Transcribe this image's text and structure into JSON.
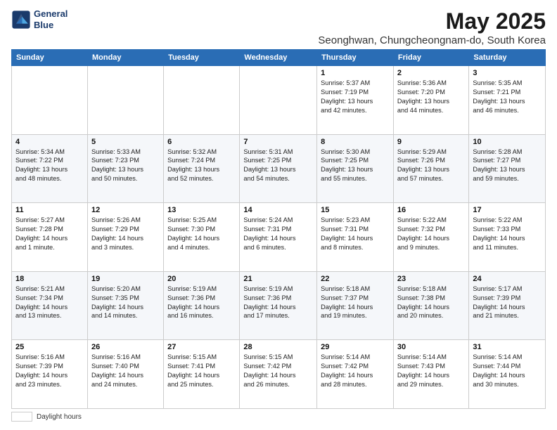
{
  "header": {
    "logo_line1": "General",
    "logo_line2": "Blue",
    "title": "May 2025",
    "subtitle": "Seonghwan, Chungcheongnam-do, South Korea"
  },
  "days_of_week": [
    "Sunday",
    "Monday",
    "Tuesday",
    "Wednesday",
    "Thursday",
    "Friday",
    "Saturday"
  ],
  "weeks": [
    [
      {
        "day": "",
        "info": ""
      },
      {
        "day": "",
        "info": ""
      },
      {
        "day": "",
        "info": ""
      },
      {
        "day": "",
        "info": ""
      },
      {
        "day": "1",
        "info": "Sunrise: 5:37 AM\nSunset: 7:19 PM\nDaylight: 13 hours\nand 42 minutes."
      },
      {
        "day": "2",
        "info": "Sunrise: 5:36 AM\nSunset: 7:20 PM\nDaylight: 13 hours\nand 44 minutes."
      },
      {
        "day": "3",
        "info": "Sunrise: 5:35 AM\nSunset: 7:21 PM\nDaylight: 13 hours\nand 46 minutes."
      }
    ],
    [
      {
        "day": "4",
        "info": "Sunrise: 5:34 AM\nSunset: 7:22 PM\nDaylight: 13 hours\nand 48 minutes."
      },
      {
        "day": "5",
        "info": "Sunrise: 5:33 AM\nSunset: 7:23 PM\nDaylight: 13 hours\nand 50 minutes."
      },
      {
        "day": "6",
        "info": "Sunrise: 5:32 AM\nSunset: 7:24 PM\nDaylight: 13 hours\nand 52 minutes."
      },
      {
        "day": "7",
        "info": "Sunrise: 5:31 AM\nSunset: 7:25 PM\nDaylight: 13 hours\nand 54 minutes."
      },
      {
        "day": "8",
        "info": "Sunrise: 5:30 AM\nSunset: 7:25 PM\nDaylight: 13 hours\nand 55 minutes."
      },
      {
        "day": "9",
        "info": "Sunrise: 5:29 AM\nSunset: 7:26 PM\nDaylight: 13 hours\nand 57 minutes."
      },
      {
        "day": "10",
        "info": "Sunrise: 5:28 AM\nSunset: 7:27 PM\nDaylight: 13 hours\nand 59 minutes."
      }
    ],
    [
      {
        "day": "11",
        "info": "Sunrise: 5:27 AM\nSunset: 7:28 PM\nDaylight: 14 hours\nand 1 minute."
      },
      {
        "day": "12",
        "info": "Sunrise: 5:26 AM\nSunset: 7:29 PM\nDaylight: 14 hours\nand 3 minutes."
      },
      {
        "day": "13",
        "info": "Sunrise: 5:25 AM\nSunset: 7:30 PM\nDaylight: 14 hours\nand 4 minutes."
      },
      {
        "day": "14",
        "info": "Sunrise: 5:24 AM\nSunset: 7:31 PM\nDaylight: 14 hours\nand 6 minutes."
      },
      {
        "day": "15",
        "info": "Sunrise: 5:23 AM\nSunset: 7:31 PM\nDaylight: 14 hours\nand 8 minutes."
      },
      {
        "day": "16",
        "info": "Sunrise: 5:22 AM\nSunset: 7:32 PM\nDaylight: 14 hours\nand 9 minutes."
      },
      {
        "day": "17",
        "info": "Sunrise: 5:22 AM\nSunset: 7:33 PM\nDaylight: 14 hours\nand 11 minutes."
      }
    ],
    [
      {
        "day": "18",
        "info": "Sunrise: 5:21 AM\nSunset: 7:34 PM\nDaylight: 14 hours\nand 13 minutes."
      },
      {
        "day": "19",
        "info": "Sunrise: 5:20 AM\nSunset: 7:35 PM\nDaylight: 14 hours\nand 14 minutes."
      },
      {
        "day": "20",
        "info": "Sunrise: 5:19 AM\nSunset: 7:36 PM\nDaylight: 14 hours\nand 16 minutes."
      },
      {
        "day": "21",
        "info": "Sunrise: 5:19 AM\nSunset: 7:36 PM\nDaylight: 14 hours\nand 17 minutes."
      },
      {
        "day": "22",
        "info": "Sunrise: 5:18 AM\nSunset: 7:37 PM\nDaylight: 14 hours\nand 19 minutes."
      },
      {
        "day": "23",
        "info": "Sunrise: 5:18 AM\nSunset: 7:38 PM\nDaylight: 14 hours\nand 20 minutes."
      },
      {
        "day": "24",
        "info": "Sunrise: 5:17 AM\nSunset: 7:39 PM\nDaylight: 14 hours\nand 21 minutes."
      }
    ],
    [
      {
        "day": "25",
        "info": "Sunrise: 5:16 AM\nSunset: 7:39 PM\nDaylight: 14 hours\nand 23 minutes."
      },
      {
        "day": "26",
        "info": "Sunrise: 5:16 AM\nSunset: 7:40 PM\nDaylight: 14 hours\nand 24 minutes."
      },
      {
        "day": "27",
        "info": "Sunrise: 5:15 AM\nSunset: 7:41 PM\nDaylight: 14 hours\nand 25 minutes."
      },
      {
        "day": "28",
        "info": "Sunrise: 5:15 AM\nSunset: 7:42 PM\nDaylight: 14 hours\nand 26 minutes."
      },
      {
        "day": "29",
        "info": "Sunrise: 5:14 AM\nSunset: 7:42 PM\nDaylight: 14 hours\nand 28 minutes."
      },
      {
        "day": "30",
        "info": "Sunrise: 5:14 AM\nSunset: 7:43 PM\nDaylight: 14 hours\nand 29 minutes."
      },
      {
        "day": "31",
        "info": "Sunrise: 5:14 AM\nSunset: 7:44 PM\nDaylight: 14 hours\nand 30 minutes."
      }
    ]
  ],
  "footer": {
    "label": "Daylight hours"
  }
}
